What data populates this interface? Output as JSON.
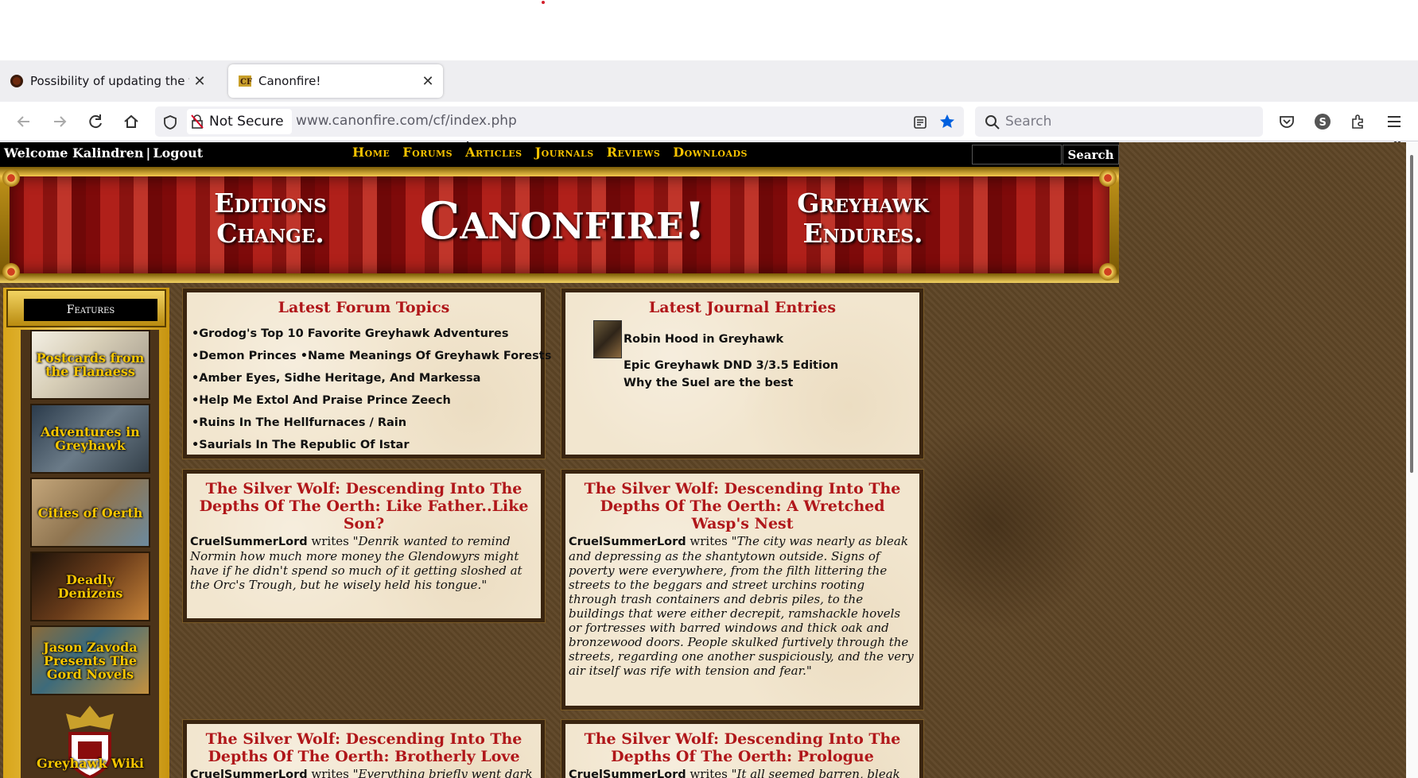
{
  "browser": {
    "tabs": [
      {
        "title": "Possibility of updating the forum",
        "active": false
      },
      {
        "title": "Canonfire!",
        "active": true
      }
    ],
    "new_tab_label": "+",
    "security_label": "Not Secure",
    "url": "www.canonfire.com/cf/index.php",
    "search_placeholder": "Search",
    "account_initial": "S"
  },
  "site": {
    "topbar": {
      "welcome": "Welcome Kalindren",
      "separator": "|",
      "logout": "Logout",
      "search_button": "Search"
    },
    "nav": [
      "Home",
      "Forums",
      "Articles",
      "Journals",
      "Reviews",
      "Downloads"
    ],
    "banner": {
      "left_line1": "Editions",
      "left_line2": "Change.",
      "center": "Canonfire!",
      "right_line1": "Greyhawk",
      "right_line2": "Endures."
    },
    "features": {
      "heading": "Features",
      "items": [
        "Postcards from the Flanaess",
        "Adventures in Greyhawk",
        "Cities of Oerth",
        "Deadly Denizens",
        "Jason Zavoda Presents The Gord Novels",
        "Greyhawk Wiki"
      ]
    },
    "forum": {
      "title": "Latest Forum Topics",
      "topics": [
        "•Grodog's Top 10 Favorite Greyhawk Adventures",
        "•Demon Princes •Name Meanings Of Greyhawk Forests",
        "•Amber Eyes, Sidhe Heritage, And Markessa",
        "•Help Me Extol And Praise Prince Zeech",
        "•Ruins In The Hellfurnaces / Rain",
        "•Saurials In The Republic Of Istar"
      ]
    },
    "journal": {
      "title": "Latest Journal Entries",
      "entries": [
        "Robin Hood in Greyhawk",
        "Epic Greyhawk DND 3/3.5 Edition",
        "Why the Suel are the best"
      ]
    },
    "articles": [
      {
        "title": "The Silver Wolf: Descending Into The Depths Of The Oerth: Like Father..Like Son?",
        "author": "CruelSummerLord",
        "verb": "writes",
        "excerpt": "\"Denrik wanted to remind Normin how much more money the Glendowyrs might have if he didn't spend so much of it getting sloshed at the Orc's Trough, but he wisely held his tongue.\""
      },
      {
        "title": "The Silver Wolf: Descending Into The Depths Of The Oerth: A Wretched Wasp's Nest",
        "author": "CruelSummerLord",
        "verb": "writes",
        "excerpt": "\"The city was nearly as bleak and depressing as the shantytown outside. Signs of poverty were everywhere, from the filth littering the streets to the beggars and street urchins rooting through trash containers and debris piles, to the buildings that were either decrepit, ramshackle hovels or fortresses with barred windows and thick oak and bronzewood doors. People skulked furtively through the streets, regarding one another suspiciously, and the very air itself was rife with tension and fear.\""
      },
      {
        "title": "The Silver Wolf: Descending Into The Depths Of The Oerth: Brotherly Love",
        "author": "CruelSummerLord",
        "verb": "writes",
        "excerpt": "\"Everything briefly went dark"
      },
      {
        "title": "The Silver Wolf: Descending Into The Depths Of The Oerth: Prologue",
        "author": "CruelSummerLord",
        "verb": "writes",
        "excerpt": "\"It all seemed barren, bleak"
      }
    ]
  },
  "colors": {
    "title_red": "#b0171a",
    "nav_gold": "#f7c300",
    "parchment": "#f2e6cf",
    "bookmark_blue": "#0060df"
  }
}
